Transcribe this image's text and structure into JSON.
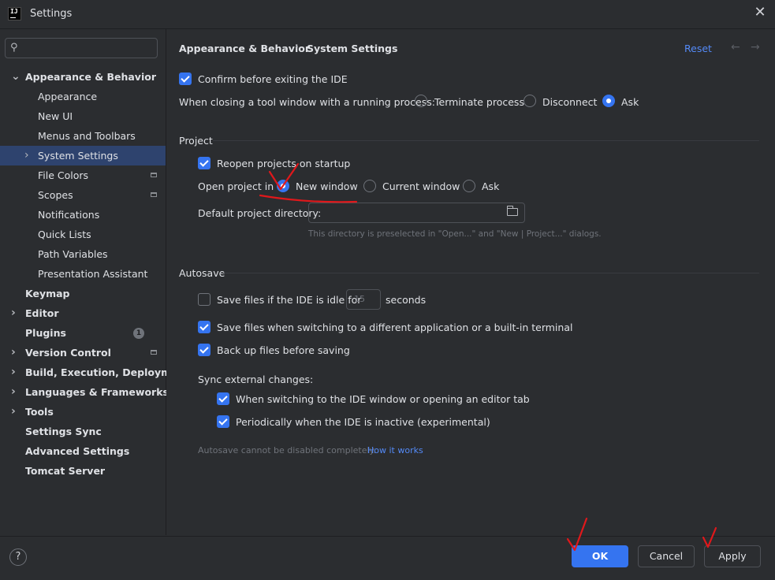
{
  "window": {
    "title": "Settings",
    "app_icon_text": "IJ"
  },
  "search": {
    "placeholder": ""
  },
  "sidebar": {
    "items": [
      {
        "label": "Appearance & Behavior",
        "bold": true,
        "arrow": "expanded"
      },
      {
        "label": "Appearance"
      },
      {
        "label": "New UI"
      },
      {
        "label": "Menus and Toolbars"
      },
      {
        "label": "System Settings",
        "selected": true,
        "arrow": "collapsed"
      },
      {
        "label": "File Colors",
        "scope_icon": true
      },
      {
        "label": "Scopes",
        "scope_icon": true
      },
      {
        "label": "Notifications"
      },
      {
        "label": "Quick Lists"
      },
      {
        "label": "Path Variables"
      },
      {
        "label": "Presentation Assistant"
      },
      {
        "label": "Keymap",
        "bold": true
      },
      {
        "label": "Editor",
        "bold": true,
        "arrow": "collapsed"
      },
      {
        "label": "Plugins",
        "bold": true,
        "badge": "1"
      },
      {
        "label": "Version Control",
        "bold": true,
        "arrow": "collapsed",
        "scope_icon": true
      },
      {
        "label": "Build, Execution, Deployment",
        "bold": true,
        "arrow": "collapsed"
      },
      {
        "label": "Languages & Frameworks",
        "bold": true,
        "arrow": "collapsed"
      },
      {
        "label": "Tools",
        "bold": true,
        "arrow": "collapsed"
      },
      {
        "label": "Settings Sync",
        "bold": true
      },
      {
        "label": "Advanced Settings",
        "bold": true
      },
      {
        "label": "Tomcat Server",
        "bold": true
      }
    ]
  },
  "header": {
    "breadcrumb_parent": "Appearance & Behavior",
    "breadcrumb_sep": "›",
    "breadcrumb_current": "System Settings",
    "reset_label": "Reset",
    "back_glyph": "←",
    "forward_glyph": "→"
  },
  "general": {
    "confirm_exit_label": "Confirm before exiting the IDE",
    "confirm_exit_checked": true,
    "closing_tool_window_label": "When closing a tool window with a running process:",
    "closing_options": [
      "Terminate process",
      "Disconnect",
      "Ask"
    ],
    "closing_selected": "Ask"
  },
  "project": {
    "section_title": "Project",
    "reopen_label": "Reopen projects on startup",
    "reopen_checked": true,
    "open_in_label": "Open project in",
    "open_in_options": [
      "New window",
      "Current window",
      "Ask"
    ],
    "open_in_selected": "New window",
    "default_dir_label": "Default project directory:",
    "default_dir_value": "",
    "default_dir_hint": "This directory is preselected in \"Open...\" and \"New | Project...\" dialogs."
  },
  "autosave": {
    "section_title": "Autosave",
    "idle_label": "Save files if the IDE is idle for",
    "idle_checked": false,
    "idle_value": "15",
    "idle_unit": "seconds",
    "switch_app_label": "Save files when switching to a different application or a built-in terminal",
    "switch_app_checked": true,
    "backup_label": "Back up files before saving",
    "backup_checked": true,
    "sync_title": "Sync external changes:",
    "sync_switch_label": "When switching to the IDE window or opening an editor tab",
    "sync_switch_checked": true,
    "sync_periodic_label": "Periodically when the IDE is inactive (experimental)",
    "sync_periodic_checked": true,
    "note": "Autosave cannot be disabled completely.",
    "how_it_works": "How it works"
  },
  "footer": {
    "help_glyph": "?",
    "ok_label": "OK",
    "cancel_label": "Cancel",
    "apply_label": "Apply"
  },
  "colors": {
    "accent": "#3574f0",
    "link": "#548af7",
    "selection": "#2e436e",
    "annotation": "#e0181b"
  }
}
